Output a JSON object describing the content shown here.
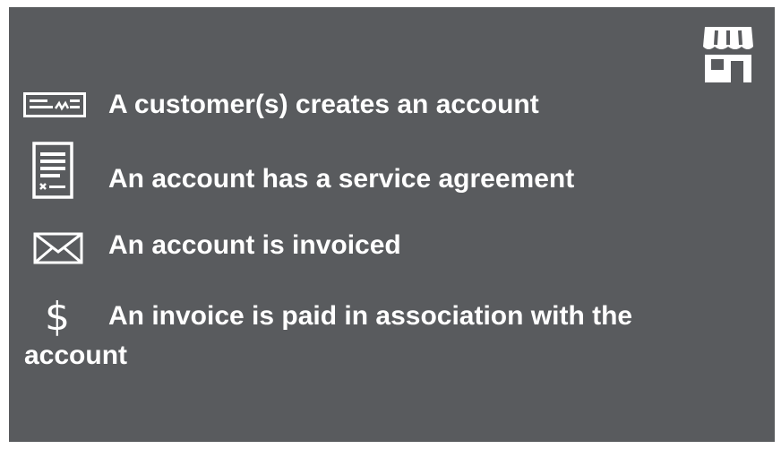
{
  "colors": {
    "background": "#595b5e",
    "foreground": "#ffffff"
  },
  "icons": {
    "top_right": "storefront-icon",
    "row1": "check-payment-icon",
    "row2": "contract-document-icon",
    "row3": "envelope-icon",
    "row4": "dollar-sign-icon"
  },
  "items": [
    {
      "text": "A customer(s) creates an account"
    },
    {
      "text": "An account has a service agreement"
    },
    {
      "text": "An account is invoiced"
    },
    {
      "icon_glyph": "$",
      "text": "An invoice is paid in association with the",
      "text_cont": "account"
    }
  ]
}
